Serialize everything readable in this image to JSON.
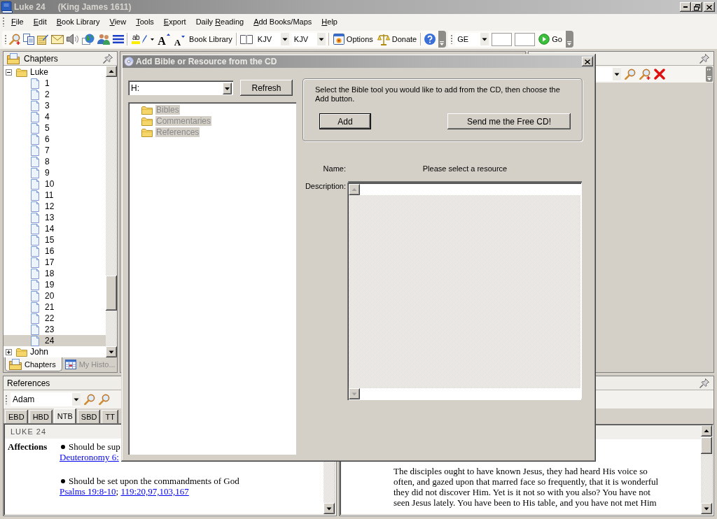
{
  "window": {
    "title": "Luke 24",
    "subtitle": "(King James 1611)"
  },
  "menu": [
    {
      "key": "F",
      "after": "ile"
    },
    {
      "key": "E",
      "after": "dit"
    },
    {
      "key": "B",
      "after": "ook Library"
    },
    {
      "key": "V",
      "after": "iew"
    },
    {
      "key": "T",
      "after": "ools"
    },
    {
      "key": "E",
      "after": "xport"
    },
    {
      "before": "Daily ",
      "key": "R",
      "after": "eading"
    },
    {
      "key": "A",
      "after": "dd Books/Maps"
    },
    {
      "key": "H",
      "after": "elp"
    }
  ],
  "toolbar": {
    "highlight_glyph": "ab",
    "font_buttons": [
      {
        "kind": "grow",
        "glyph": "A"
      },
      {
        "kind": "shrink",
        "glyph": "A"
      }
    ],
    "book_library": "Book Library",
    "versions": [
      "KJV",
      "KJV"
    ],
    "options": "Options",
    "donate": "Donate"
  },
  "navigation": {
    "book": "GE",
    "go": "Go"
  },
  "chapters": {
    "title": "Chapters",
    "tree": [
      {
        "label": "Luke",
        "expanded": true,
        "selected": false,
        "children": [
          {
            "label": "1",
            "selected": false
          },
          {
            "label": "2",
            "selected": false
          },
          {
            "label": "3",
            "selected": false
          },
          {
            "label": "4",
            "selected": false
          },
          {
            "label": "5",
            "selected": false
          },
          {
            "label": "6",
            "selected": false
          },
          {
            "label": "7",
            "selected": false
          },
          {
            "label": "8",
            "selected": false
          },
          {
            "label": "9",
            "selected": false
          },
          {
            "label": "10",
            "selected": false
          },
          {
            "label": "11",
            "selected": false
          },
          {
            "label": "12",
            "selected": false
          },
          {
            "label": "13",
            "selected": false
          },
          {
            "label": "14",
            "selected": false
          },
          {
            "label": "15",
            "selected": false
          },
          {
            "label": "16",
            "selected": false
          },
          {
            "label": "17",
            "selected": false
          },
          {
            "label": "18",
            "selected": false
          },
          {
            "label": "19",
            "selected": false
          },
          {
            "label": "20",
            "selected": false
          },
          {
            "label": "21",
            "selected": false
          },
          {
            "label": "22",
            "selected": false
          },
          {
            "label": "23",
            "selected": false
          },
          {
            "label": "24",
            "selected": true
          }
        ]
      },
      {
        "label": "John",
        "expanded": false,
        "selected": false
      }
    ],
    "tabs": [
      {
        "label": "Chapters",
        "selected": true
      },
      {
        "label": "My Histo...",
        "selected": false
      }
    ]
  },
  "dialog": {
    "title": "Add Bible or Resource from the CD",
    "drive": "H:",
    "refresh": "Refresh",
    "resources": [
      {
        "label": "Bibles",
        "disabled": true
      },
      {
        "label": "Commentaries",
        "disabled": true
      },
      {
        "label": "References",
        "disabled": true
      }
    ],
    "instructions": "Select the Bible tool you would like to add from the CD, then choose the Add button.",
    "actions": [
      {
        "label": "Add",
        "default": true
      },
      {
        "label": "Send me the Free CD!",
        "default": false
      }
    ],
    "name_label": "Name:",
    "name_value": "Please select a resource",
    "description_label": "Description:"
  },
  "references": {
    "title": "References",
    "search": "Adam",
    "tabs": [
      {
        "label": "EBD",
        "selected": false
      },
      {
        "label": "HBD",
        "selected": false
      },
      {
        "label": "NTB",
        "selected": true
      },
      {
        "label": "SBD",
        "selected": false
      },
      {
        "label": "TT",
        "selected": false
      }
    ],
    "heading": "LUKE 24",
    "topic": "Affections",
    "link_separator": ";",
    "entries": [
      {
        "text": "Should be sup",
        "links": [
          "Deuteronomy 6:"
        ]
      },
      {
        "text": "Should be set upon the commandments of God",
        "links": [
          "Psalms 19:8-10",
          "119:20,97,103,167"
        ]
      }
    ]
  },
  "devotional": {
    "text": "The disciples ought to have known Jesus, they had heard His voice so often, and gazed upon that marred face so frequently, that it is wonderful they did not discover Him. Yet is it not so with you also? You have not seen Jesus lately. You have been to His table, and you have not met Him"
  }
}
